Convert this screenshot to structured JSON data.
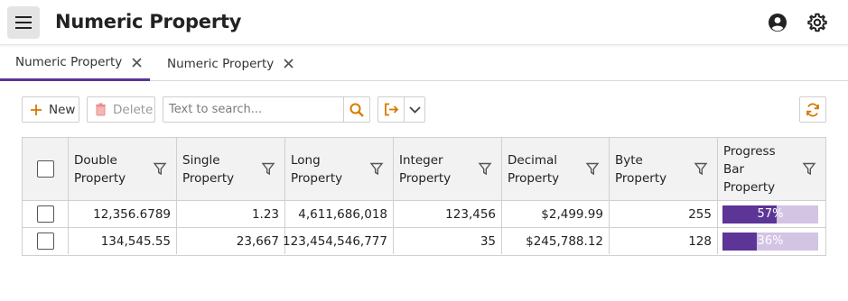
{
  "header": {
    "title": "Numeric Property",
    "icons": [
      "menu-icon",
      "account-icon",
      "gear-icon"
    ]
  },
  "tabs": [
    {
      "label": "Numeric Property",
      "active": true
    },
    {
      "label": "Numeric Property",
      "active": false
    }
  ],
  "toolbar": {
    "new_label": "New",
    "delete_label": "Delete",
    "search_placeholder": "Text to search...",
    "search_value": ""
  },
  "colors": {
    "accent": "#5c3596",
    "progress_track": "#d3c4e4",
    "action_orange": "#d97800"
  },
  "grid": {
    "columns": [
      {
        "label": "Double Property"
      },
      {
        "label": "Single Property"
      },
      {
        "label": "Long Property"
      },
      {
        "label": "Integer Property"
      },
      {
        "label": "Decimal Property"
      },
      {
        "label": "Byte Property"
      },
      {
        "label": "Progress Bar Property"
      }
    ],
    "rows": [
      {
        "double": "12,356.6789",
        "single": "1.23",
        "long": "4,611,686,018",
        "integer": "123,456",
        "decimal": "$2,499.99",
        "byte": "255",
        "progress": 57,
        "progress_text": "57%"
      },
      {
        "double": "134,545.55",
        "single": "23,667",
        "long": "123,454,546,777",
        "integer": "35",
        "decimal": "$245,788.12",
        "byte": "128",
        "progress": 36,
        "progress_text": "36%"
      }
    ]
  }
}
